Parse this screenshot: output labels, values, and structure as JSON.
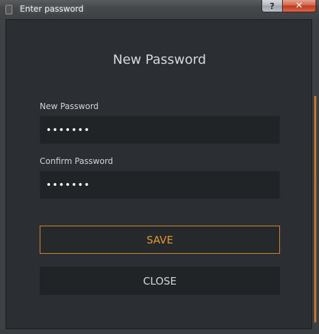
{
  "window": {
    "title": "Enter password",
    "help_label": "?",
    "close_label": "✕"
  },
  "dialog": {
    "heading": "New Password",
    "new_password": {
      "label": "New Password",
      "value": "•••••••"
    },
    "confirm_password": {
      "label": "Confirm Password",
      "value": "•••••••"
    },
    "save_label": "SAVE",
    "close_label": "CLOSE"
  },
  "colors": {
    "accent": "#e39a2c",
    "background": "#2b2f33",
    "field_background": "#212427"
  }
}
